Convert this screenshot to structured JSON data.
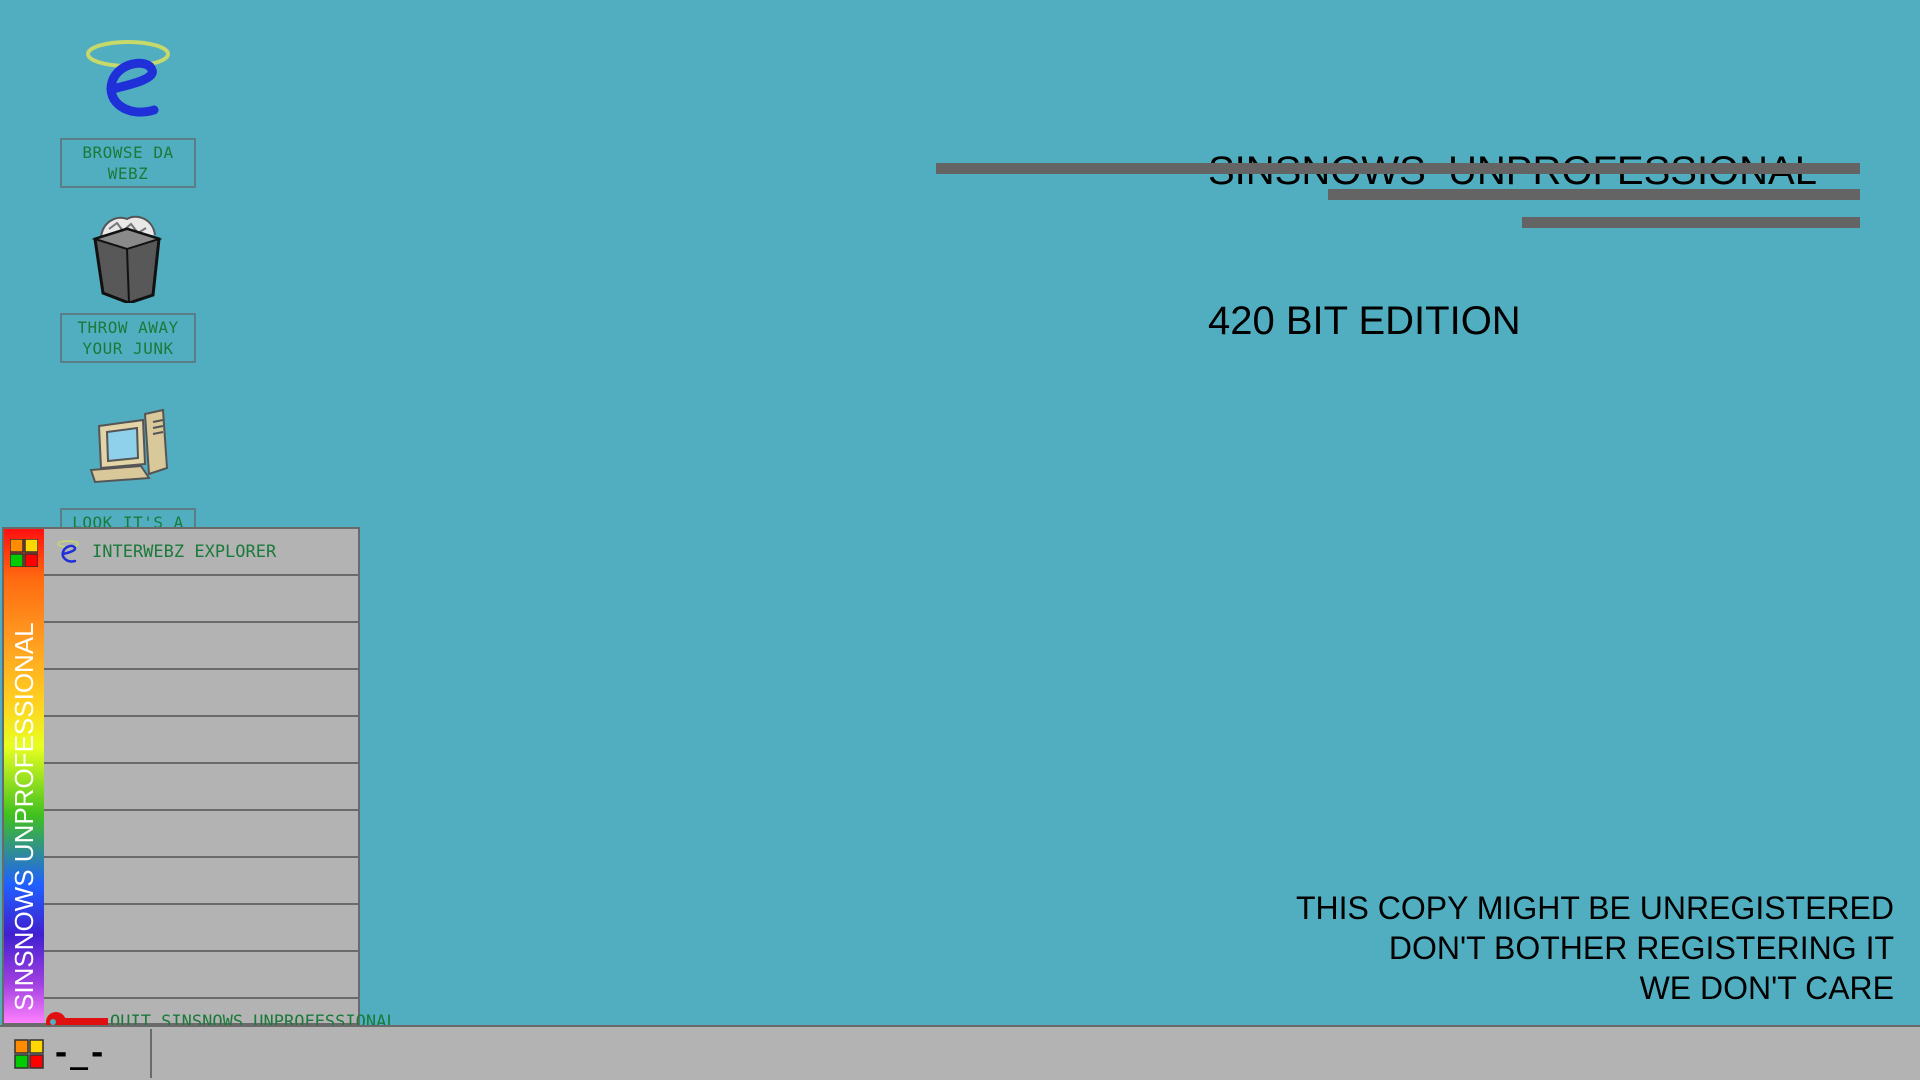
{
  "desktop": {
    "background_color": "#51aec0",
    "icons": [
      {
        "name": "browser-icon",
        "label": "BROWSE DA\nWEBZ"
      },
      {
        "name": "trash-icon",
        "label": "THROW AWAY\nYOUR JUNK"
      },
      {
        "name": "computer-icon",
        "label": "LOOK IT'S A"
      }
    ]
  },
  "title": {
    "line1": "SINSNOWS  UNPROFESSIONAL",
    "line2": "420 BIT EDITION"
  },
  "watermark": {
    "line1": "THIS COPY MIGHT BE UNREGISTERED",
    "line2": "DON'T BOTHER REGISTERING IT",
    "line3": "WE DON'T CARE"
  },
  "start_menu": {
    "rail_text": "SINSNOWS UNPROFESSIONAL",
    "items": [
      {
        "label": "INTERWEBZ EXPLORER",
        "icon": "browser-icon"
      },
      {
        "label": ""
      },
      {
        "label": ""
      },
      {
        "label": ""
      },
      {
        "label": ""
      },
      {
        "label": ""
      },
      {
        "label": ""
      },
      {
        "label": ""
      },
      {
        "label": ""
      },
      {
        "label": ""
      }
    ],
    "quit": {
      "label": "QUIT SINSNOWS UNPROFESSIONAL",
      "icon": "key-icon"
    }
  },
  "taskbar": {
    "start_label": "-_-",
    "logo_colors": [
      "#ff8c00",
      "#ffd700",
      "#00cc00",
      "#ff0000"
    ]
  },
  "colors": {
    "menu_bg": "#b3b3b3",
    "label_text": "#1a7a3a",
    "bar": "#646464"
  }
}
